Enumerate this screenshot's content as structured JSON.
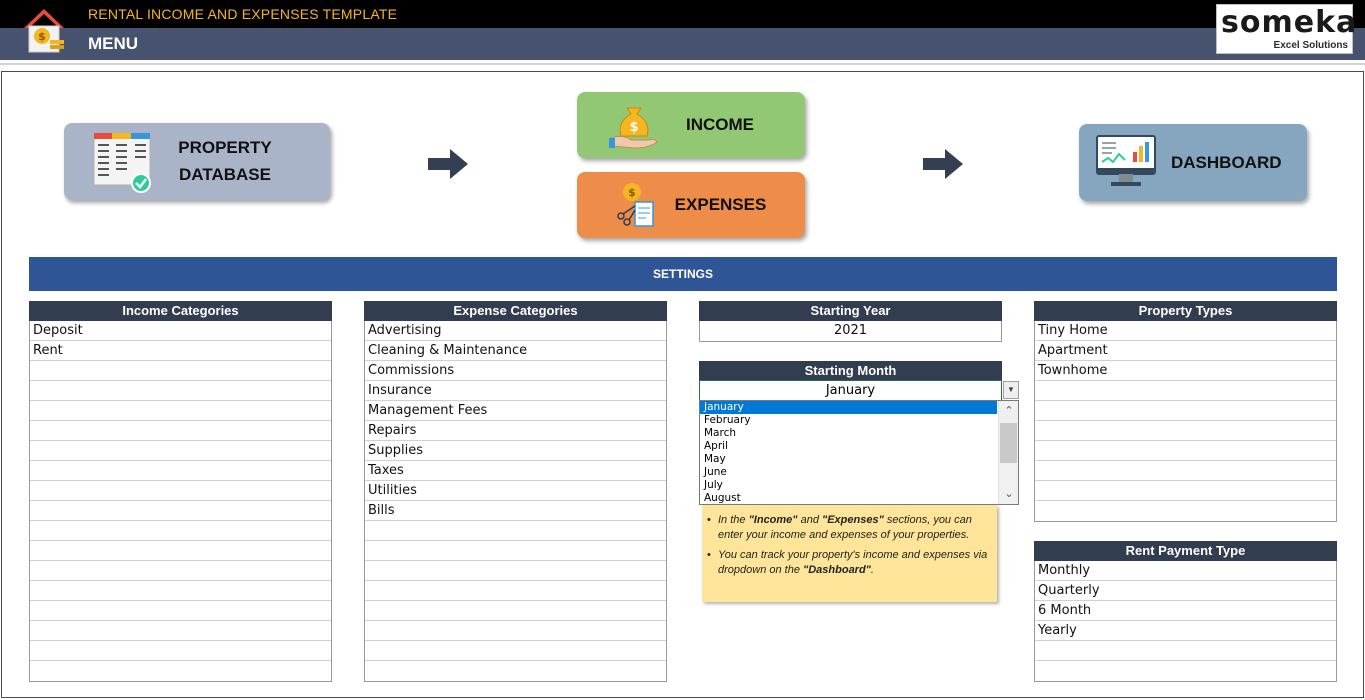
{
  "header": {
    "app_title": "RENTAL INCOME AND EXPENSES TEMPLATE",
    "menu_label": "MENU",
    "logo_main": "someka",
    "logo_sub": "Excel Solutions"
  },
  "nav": {
    "property_line1": "PROPERTY",
    "property_line2": "DATABASE",
    "income": "INCOME",
    "expenses": "EXPENSES",
    "dashboard": "DASHBOARD"
  },
  "settings_label": "SETTINGS",
  "income_categories": {
    "header": "Income Categories",
    "items": [
      "Deposit",
      "Rent",
      "",
      "",
      "",
      "",
      "",
      "",
      "",
      "",
      "",
      "",
      "",
      "",
      "",
      "",
      "",
      ""
    ]
  },
  "expense_categories": {
    "header": "Expense Categories",
    "items": [
      "Advertising",
      "Cleaning & Maintenance",
      "Commissions",
      "Insurance",
      "Management Fees",
      "Repairs",
      "Supplies",
      "Taxes",
      "Utilities",
      "Bills",
      "",
      "",
      "",
      "",
      "",
      "",
      "",
      ""
    ]
  },
  "starting_year": {
    "header": "Starting Year",
    "value": "2021"
  },
  "starting_month": {
    "header": "Starting Month",
    "value": "January",
    "options": [
      "January",
      "February",
      "March",
      "April",
      "May",
      "June",
      "July",
      "August"
    ],
    "selected": "January"
  },
  "property_types": {
    "header": "Property Types",
    "items": [
      "Tiny Home",
      "Apartment",
      "Townhome",
      "",
      "",
      "",
      "",
      "",
      "",
      ""
    ]
  },
  "rent_payment_type": {
    "header": "Rent Payment Type",
    "items": [
      "Monthly",
      "Quarterly",
      "6 Month",
      "Yearly",
      "",
      ""
    ]
  },
  "note": {
    "p1_a": "In the ",
    "p1_b": "\"Income\"",
    "p1_c": " and ",
    "p1_d": "\"Expenses\"",
    "p1_e": " sections, you can enter your income and expenses of your properties.",
    "p2_a": "You can track your property's income and expenses via dropdown on the ",
    "p2_b": "\"Dashboard\"",
    "p2_c": "."
  },
  "colors": {
    "header_bg": "#47536e",
    "title_accent": "#f5b622",
    "settings_bar": "#2f5597",
    "table_header": "#323e50",
    "income_btn": "#92c874",
    "expenses_btn": "#ee8c49",
    "property_btn": "#a9b4c9",
    "dashboard_btn": "#86a5bf",
    "note_bg": "#ffe599",
    "selection": "#0078d7"
  }
}
